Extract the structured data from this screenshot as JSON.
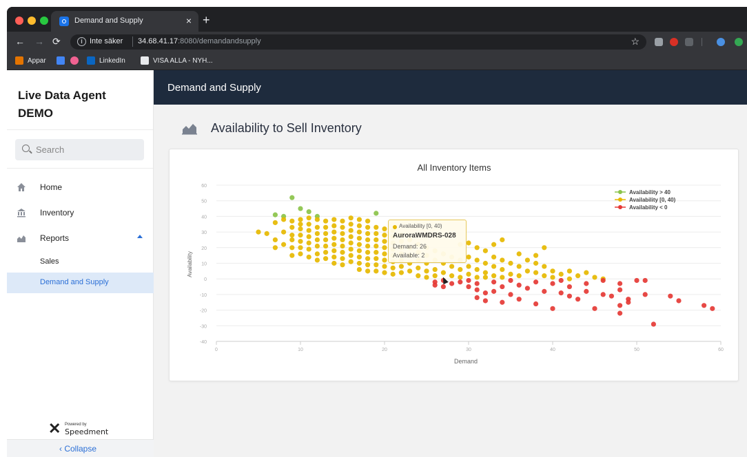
{
  "browser": {
    "tab_title": "Demand and Supply",
    "tab_close": "×",
    "new_tab": "+",
    "secure_label": "Inte säker",
    "url_host": "34.68.41.17",
    "url_rest": ":8080/demandandsupply",
    "bookmarks": [
      "Appar",
      "LinkedIn",
      "VISA ALLA - NYH..."
    ]
  },
  "app": {
    "brand": "Live Data Agent DEMO",
    "search_placeholder": "Search",
    "nav": [
      "Home",
      "Inventory",
      "Reports"
    ],
    "subnav": [
      "Sales",
      "Demand and Supply"
    ],
    "powered_small": "Powered by",
    "powered_name": "Speedment",
    "collapse": "‹  Collapse",
    "header_title": "Demand and Supply",
    "page_title": "Availability to Sell Inventory"
  },
  "tooltip": {
    "series": "Availability [0, 40)",
    "item": "AuroraWMDRS-028",
    "demand": "Demand: 26",
    "available": "Available: 2"
  },
  "chart_data": {
    "type": "scatter",
    "title": "All Inventory Items",
    "xlabel": "Demand",
    "ylabel": "Availability",
    "xlim": [
      0,
      60
    ],
    "ylim": [
      -40,
      60
    ],
    "xticks": [
      0,
      10,
      20,
      30,
      40,
      50,
      60
    ],
    "yticks": [
      -40,
      -30,
      -20,
      -10,
      0,
      10,
      20,
      30,
      40,
      50,
      60
    ],
    "grid": true,
    "legend_position": "top-right",
    "series": [
      {
        "name": "Availability > 40",
        "color": "#8bc34a",
        "points": [
          [
            9,
            52
          ],
          [
            10,
            45
          ],
          [
            11,
            43
          ],
          [
            12,
            40
          ],
          [
            19,
            42
          ],
          [
            7,
            41
          ],
          [
            8,
            40
          ]
        ]
      },
      {
        "name": "Availability [0, 40)",
        "color": "#e6b800",
        "points": [
          [
            5,
            30
          ],
          [
            6,
            29
          ],
          [
            7,
            25
          ],
          [
            7,
            36
          ],
          [
            7,
            20
          ],
          [
            8,
            38
          ],
          [
            8,
            30
          ],
          [
            8,
            22
          ],
          [
            9,
            37
          ],
          [
            9,
            33
          ],
          [
            9,
            28
          ],
          [
            9,
            25
          ],
          [
            9,
            20
          ],
          [
            9,
            15
          ],
          [
            10,
            38
          ],
          [
            10,
            35
          ],
          [
            10,
            32
          ],
          [
            10,
            28
          ],
          [
            10,
            24
          ],
          [
            10,
            20
          ],
          [
            10,
            16
          ],
          [
            11,
            39
          ],
          [
            11,
            35
          ],
          [
            11,
            31
          ],
          [
            11,
            27
          ],
          [
            11,
            23
          ],
          [
            11,
            19
          ],
          [
            11,
            14
          ],
          [
            12,
            38
          ],
          [
            12,
            33
          ],
          [
            12,
            29
          ],
          [
            12,
            25
          ],
          [
            12,
            21
          ],
          [
            12,
            16
          ],
          [
            12,
            12
          ],
          [
            13,
            37
          ],
          [
            13,
            33
          ],
          [
            13,
            29
          ],
          [
            13,
            25
          ],
          [
            13,
            21
          ],
          [
            13,
            17
          ],
          [
            13,
            13
          ],
          [
            14,
            38
          ],
          [
            14,
            34
          ],
          [
            14,
            30
          ],
          [
            14,
            26
          ],
          [
            14,
            22
          ],
          [
            14,
            18
          ],
          [
            14,
            14
          ],
          [
            14,
            10
          ],
          [
            15,
            37
          ],
          [
            15,
            33
          ],
          [
            15,
            29
          ],
          [
            15,
            25
          ],
          [
            15,
            21
          ],
          [
            15,
            17
          ],
          [
            15,
            13
          ],
          [
            15,
            9
          ],
          [
            16,
            39
          ],
          [
            16,
            35
          ],
          [
            16,
            31
          ],
          [
            16,
            27
          ],
          [
            16,
            23
          ],
          [
            16,
            19
          ],
          [
            16,
            15
          ],
          [
            16,
            11
          ],
          [
            17,
            38
          ],
          [
            17,
            34
          ],
          [
            17,
            30
          ],
          [
            17,
            26
          ],
          [
            17,
            22
          ],
          [
            17,
            18
          ],
          [
            17,
            14
          ],
          [
            17,
            10
          ],
          [
            17,
            6
          ],
          [
            18,
            37
          ],
          [
            18,
            33
          ],
          [
            18,
            29
          ],
          [
            18,
            25
          ],
          [
            18,
            21
          ],
          [
            18,
            17
          ],
          [
            18,
            13
          ],
          [
            18,
            9
          ],
          [
            18,
            5
          ],
          [
            19,
            33
          ],
          [
            19,
            29
          ],
          [
            19,
            25
          ],
          [
            19,
            21
          ],
          [
            19,
            17
          ],
          [
            19,
            13
          ],
          [
            19,
            9
          ],
          [
            19,
            5
          ],
          [
            20,
            32
          ],
          [
            20,
            28
          ],
          [
            20,
            24
          ],
          [
            20,
            20
          ],
          [
            20,
            16
          ],
          [
            20,
            12
          ],
          [
            20,
            8
          ],
          [
            20,
            4
          ],
          [
            21,
            31
          ],
          [
            21,
            27
          ],
          [
            21,
            23
          ],
          [
            21,
            19
          ],
          [
            21,
            15
          ],
          [
            21,
            11
          ],
          [
            21,
            7
          ],
          [
            21,
            3
          ],
          [
            22,
            28
          ],
          [
            22,
            24
          ],
          [
            22,
            20
          ],
          [
            22,
            16
          ],
          [
            22,
            12
          ],
          [
            22,
            8
          ],
          [
            22,
            4
          ],
          [
            23,
            25
          ],
          [
            23,
            20
          ],
          [
            23,
            15
          ],
          [
            23,
            10
          ],
          [
            23,
            5
          ],
          [
            24,
            22
          ],
          [
            24,
            17
          ],
          [
            24,
            12
          ],
          [
            24,
            7
          ],
          [
            24,
            2
          ],
          [
            25,
            20
          ],
          [
            25,
            15
          ],
          [
            25,
            10
          ],
          [
            25,
            5
          ],
          [
            25,
            1
          ],
          [
            26,
            18
          ],
          [
            26,
            12
          ],
          [
            26,
            6
          ],
          [
            26,
            2
          ],
          [
            27,
            16
          ],
          [
            27,
            10
          ],
          [
            27,
            4
          ],
          [
            28,
            14
          ],
          [
            28,
            8
          ],
          [
            28,
            2
          ],
          [
            29,
            22
          ],
          [
            29,
            12
          ],
          [
            29,
            6
          ],
          [
            29,
            1
          ],
          [
            30,
            23
          ],
          [
            30,
            14
          ],
          [
            30,
            8
          ],
          [
            30,
            3
          ],
          [
            31,
            20
          ],
          [
            31,
            12
          ],
          [
            31,
            6
          ],
          [
            31,
            1
          ],
          [
            32,
            18
          ],
          [
            32,
            10
          ],
          [
            32,
            4
          ],
          [
            32,
            1
          ],
          [
            33,
            22
          ],
          [
            33,
            14
          ],
          [
            33,
            8
          ],
          [
            33,
            2
          ],
          [
            34,
            25
          ],
          [
            34,
            12
          ],
          [
            34,
            6
          ],
          [
            34,
            1
          ],
          [
            35,
            10
          ],
          [
            35,
            3
          ],
          [
            36,
            16
          ],
          [
            36,
            8
          ],
          [
            36,
            2
          ],
          [
            37,
            12
          ],
          [
            37,
            5
          ],
          [
            38,
            15
          ],
          [
            38,
            10
          ],
          [
            38,
            4
          ],
          [
            39,
            20
          ],
          [
            39,
            8
          ],
          [
            39,
            2
          ],
          [
            40,
            5
          ],
          [
            40,
            1
          ],
          [
            41,
            3
          ],
          [
            42,
            5
          ],
          [
            42,
            0
          ],
          [
            43,
            2
          ],
          [
            44,
            4
          ],
          [
            45,
            1
          ],
          [
            46,
            0
          ]
        ]
      },
      {
        "name": "Availability < 0",
        "color": "#e53935",
        "points": [
          [
            26,
            -2
          ],
          [
            26,
            -4
          ],
          [
            27,
            -1
          ],
          [
            27,
            -5
          ],
          [
            28,
            -3
          ],
          [
            29,
            -2
          ],
          [
            30,
            -1
          ],
          [
            30,
            -5
          ],
          [
            31,
            -3
          ],
          [
            31,
            -7
          ],
          [
            31,
            -12
          ],
          [
            32,
            -9
          ],
          [
            32,
            -14
          ],
          [
            33,
            -2
          ],
          [
            33,
            -8
          ],
          [
            34,
            -5
          ],
          [
            34,
            -15
          ],
          [
            35,
            -1
          ],
          [
            35,
            -10
          ],
          [
            36,
            -4
          ],
          [
            36,
            -13
          ],
          [
            37,
            -6
          ],
          [
            38,
            -2
          ],
          [
            38,
            -16
          ],
          [
            39,
            -8
          ],
          [
            40,
            -3
          ],
          [
            40,
            -19
          ],
          [
            41,
            -1
          ],
          [
            41,
            -9
          ],
          [
            42,
            -5
          ],
          [
            42,
            -11
          ],
          [
            43,
            -13
          ],
          [
            44,
            -3
          ],
          [
            44,
            -8
          ],
          [
            45,
            -19
          ],
          [
            46,
            -1
          ],
          [
            46,
            -10
          ],
          [
            47,
            -11
          ],
          [
            48,
            -3
          ],
          [
            48,
            -7
          ],
          [
            48,
            -17
          ],
          [
            48,
            -22
          ],
          [
            49,
            -13
          ],
          [
            49,
            -15
          ],
          [
            50,
            -1
          ],
          [
            51,
            -1
          ],
          [
            51,
            -10
          ],
          [
            52,
            -29
          ],
          [
            54,
            -11
          ],
          [
            55,
            -14
          ],
          [
            58,
            -17
          ],
          [
            59,
            -19
          ]
        ]
      }
    ]
  }
}
